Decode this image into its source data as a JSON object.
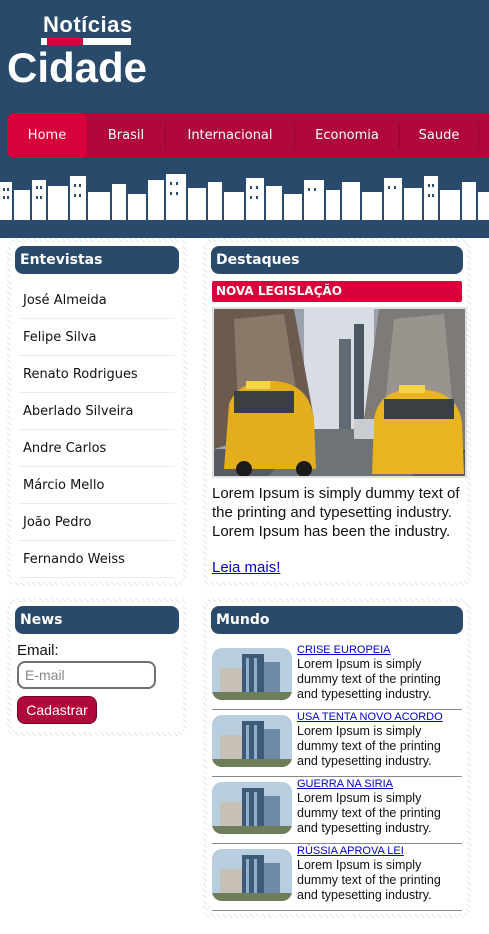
{
  "logo": {
    "top": "Notícias",
    "main": "Cidade"
  },
  "nav": {
    "items": [
      {
        "label": "Home",
        "active": true
      },
      {
        "label": "Brasil"
      },
      {
        "label": "Internacional"
      },
      {
        "label": "Economia"
      },
      {
        "label": "Saude"
      }
    ]
  },
  "entrevistas": {
    "title": "Entevistas",
    "items": [
      "José Almeida",
      "Felipe Silva",
      "Renato Rodrigues",
      "Aberlado Silveira",
      "Andre Carlos",
      "Márcio Mello",
      "João Pedro",
      "Fernando Weiss"
    ]
  },
  "news": {
    "title": "News",
    "email_label": "Email:",
    "email_placeholder": "E-mail",
    "button_label": "Cadastrar"
  },
  "destaques": {
    "title": "Destaques",
    "tag": "NOVA LEGISLAÇÃO",
    "text": "Lorem Ipsum is simply dummy text of the printing and typesetting industry. Lorem Ipsum has been the industry.",
    "link": "Leia mais!"
  },
  "mundo": {
    "title": "Mundo",
    "items": [
      {
        "headline": "CRISE EUROPEIA",
        "body": "Lorem Ipsum is simply dummy text of the printing and typesetting industry."
      },
      {
        "headline": "USA TENTA NOVO ACORDO",
        "body": "Lorem Ipsum is simply dummy text of the printing and typesetting industry."
      },
      {
        "headline": "GUERRA NA SIRIA",
        "body": "Lorem Ipsum is simply dummy text of the printing and typesetting industry."
      },
      {
        "headline": "RÚSSIA APROVA LEI",
        "body": "Lorem Ipsum is simply dummy text of the printing and typesetting industry."
      }
    ]
  },
  "colors": {
    "navy": "#2a4a6b",
    "crimson": "#b0083a",
    "red": "#d8003a"
  }
}
